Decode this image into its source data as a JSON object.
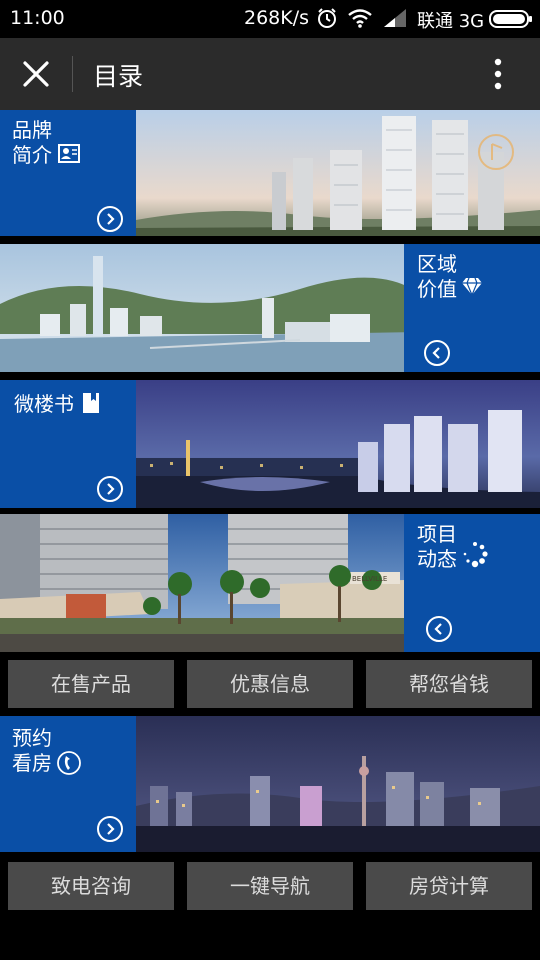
{
  "status_bar": {
    "time": "11:00",
    "speed": "268K/s",
    "carrier": "联通 3G",
    "icons": [
      "alarm-icon",
      "wifi-icon",
      "signal-icon",
      "battery-icon"
    ]
  },
  "app_bar": {
    "title": "目录",
    "close_icon": "close-icon",
    "more_icon": "more-vertical-icon"
  },
  "menu": {
    "brand": {
      "line1": "品牌",
      "line2": "简介",
      "icon": "id-card-icon",
      "arrow": "arrow-right-circle-icon"
    },
    "region": {
      "line1": "区域",
      "line2": "价值",
      "icon": "diamond-icon",
      "arrow": "arrow-left-circle-icon"
    },
    "brochure": {
      "line1": "微楼书",
      "icon": "bookmark-icon",
      "arrow": "arrow-right-circle-icon"
    },
    "news": {
      "line1": "项目",
      "line2": "动态",
      "icon": "loading-dots-icon",
      "arrow": "arrow-left-circle-icon"
    },
    "booking": {
      "line1": "预约",
      "line2": "看房",
      "icon": "phone-icon",
      "arrow": "arrow-right-circle-icon"
    }
  },
  "buttons_row1": [
    "在售产品",
    "优惠信息",
    "帮您省钱"
  ],
  "buttons_row2": [
    "致电咨询",
    "一键导航",
    "房贷计算"
  ],
  "signage": "BELLVILLE",
  "colors": {
    "panel_blue": "#0a4fa6",
    "button_grey": "#4a4a4a",
    "app_bar": "#2b2b2b"
  }
}
